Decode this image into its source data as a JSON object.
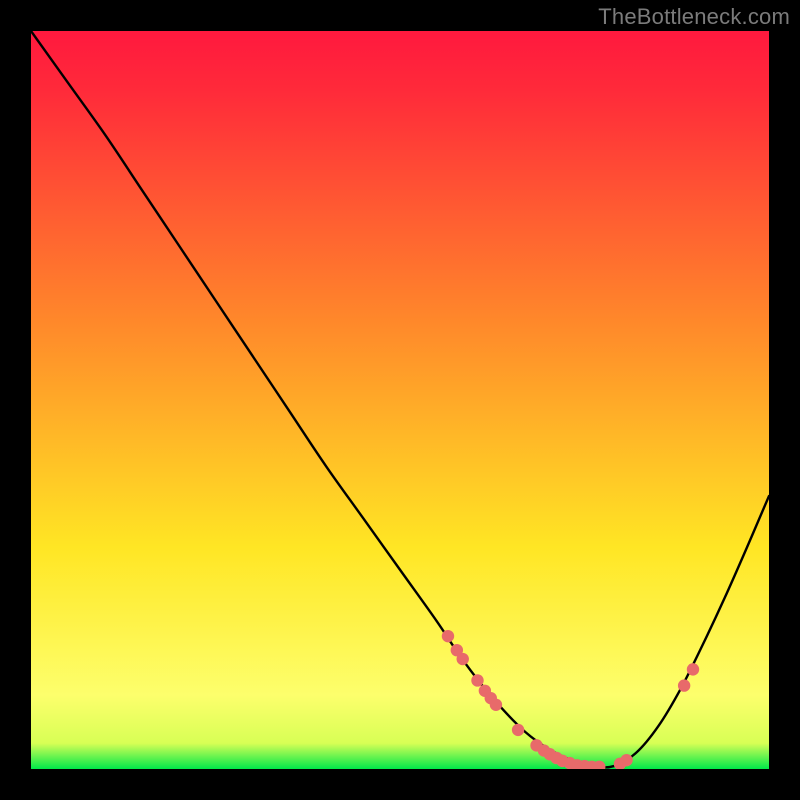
{
  "watermark": "TheBottleneck.com",
  "colors": {
    "gradient_top": "#ff193e",
    "gradient_mid1": "#ff8a2a",
    "gradient_mid2": "#ffe624",
    "gradient_mid3": "#fdff6c",
    "gradient_bottom": "#00e84a",
    "curve": "#000000",
    "marker": "#e86a6a",
    "background": "#000000"
  },
  "chart_data": {
    "type": "line",
    "title": "",
    "xlabel": "",
    "ylabel": "",
    "xlim": [
      0,
      100
    ],
    "ylim": [
      0,
      100
    ],
    "series": [
      {
        "name": "bottleneck-curve",
        "x": [
          0,
          5,
          10,
          15,
          20,
          25,
          30,
          35,
          40,
          45,
          50,
          55,
          58,
          61,
          64,
          67,
          70,
          73,
          76,
          79,
          82,
          85,
          88,
          91,
          94,
          97,
          100
        ],
        "y": [
          100,
          93,
          86,
          78.5,
          71,
          63.5,
          56,
          48.5,
          41,
          34,
          27,
          20,
          15.5,
          11.5,
          8,
          5,
          2.8,
          1.3,
          0.4,
          0.4,
          2.2,
          5.8,
          10.8,
          16.8,
          23.2,
          30,
          37
        ]
      }
    ],
    "markers": [
      {
        "x": 56.5,
        "y": 18
      },
      {
        "x": 57.7,
        "y": 16.1
      },
      {
        "x": 58.5,
        "y": 14.9
      },
      {
        "x": 60.5,
        "y": 12
      },
      {
        "x": 61.5,
        "y": 10.6
      },
      {
        "x": 62.3,
        "y": 9.6
      },
      {
        "x": 63.0,
        "y": 8.7
      },
      {
        "x": 66.0,
        "y": 5.3
      },
      {
        "x": 68.5,
        "y": 3.2
      },
      {
        "x": 69.5,
        "y": 2.5
      },
      {
        "x": 70.3,
        "y": 2.0
      },
      {
        "x": 71.2,
        "y": 1.5
      },
      {
        "x": 72.0,
        "y": 1.1
      },
      {
        "x": 73.0,
        "y": 0.8
      },
      {
        "x": 74.0,
        "y": 0.5
      },
      {
        "x": 75.0,
        "y": 0.4
      },
      {
        "x": 76.0,
        "y": 0.3
      },
      {
        "x": 77.0,
        "y": 0.3
      },
      {
        "x": 79.8,
        "y": 0.7
      },
      {
        "x": 80.7,
        "y": 1.2
      },
      {
        "x": 88.5,
        "y": 11.3
      },
      {
        "x": 89.7,
        "y": 13.5
      }
    ]
  }
}
